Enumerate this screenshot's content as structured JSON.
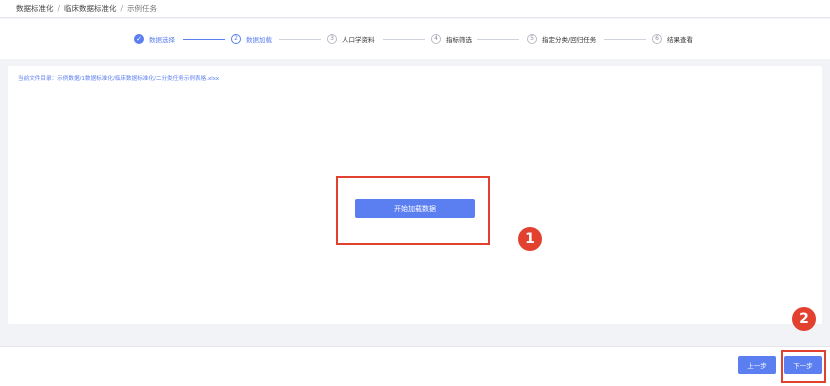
{
  "breadcrumb": {
    "items": [
      "数据标准化",
      "临床数据标准化",
      "示例任务"
    ],
    "separator": "/"
  },
  "steps": [
    {
      "index": "✓",
      "label": "数据选择",
      "state": "done"
    },
    {
      "index": "2",
      "label": "数据加载",
      "state": "active"
    },
    {
      "index": "3",
      "label": "人口学资料",
      "state": "pending"
    },
    {
      "index": "4",
      "label": "指标筛选",
      "state": "pending"
    },
    {
      "index": "5",
      "label": "指定分类/回归任务",
      "state": "pending"
    },
    {
      "index": "6",
      "label": "结果查看",
      "state": "pending"
    }
  ],
  "main": {
    "file_path": "当前文件目录：示例数据/1数据标准化/临床数据标准化/二分类任务示例表格.xlsx",
    "load_button": "开始加载数据"
  },
  "annotations": {
    "marker1": "1",
    "marker2": "2"
  },
  "footer": {
    "prev_button": "上一步",
    "next_button": "下一步"
  },
  "colors": {
    "accent": "#5b7ff0",
    "highlight": "#e2412f",
    "background": "#f2f3f7"
  }
}
